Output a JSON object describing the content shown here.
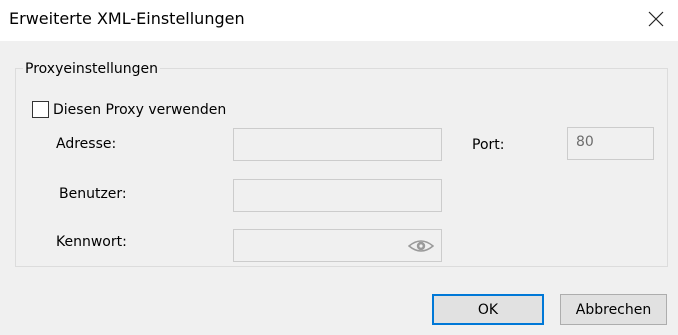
{
  "window": {
    "title": "Erweiterte XML-Einstellungen",
    "close_icon": "close-icon"
  },
  "proxy_group": {
    "legend": "Proxyeinstellungen",
    "use_proxy": {
      "label": "Diesen Proxy verwenden",
      "checked": false
    },
    "address": {
      "label": "Adresse:",
      "value": ""
    },
    "port": {
      "label": "Port:",
      "value": "80"
    },
    "user": {
      "label": "Benutzer:",
      "value": ""
    },
    "password": {
      "label": "Kennwort:",
      "value": "",
      "reveal_icon": "eye-icon"
    }
  },
  "buttons": {
    "ok": "OK",
    "cancel": "Abbrechen"
  },
  "colors": {
    "dialog_bg": "#f0f0f0",
    "titlebar_bg": "#ffffff",
    "default_button_border": "#0078d7",
    "disabled_text": "#6d6d6d"
  }
}
